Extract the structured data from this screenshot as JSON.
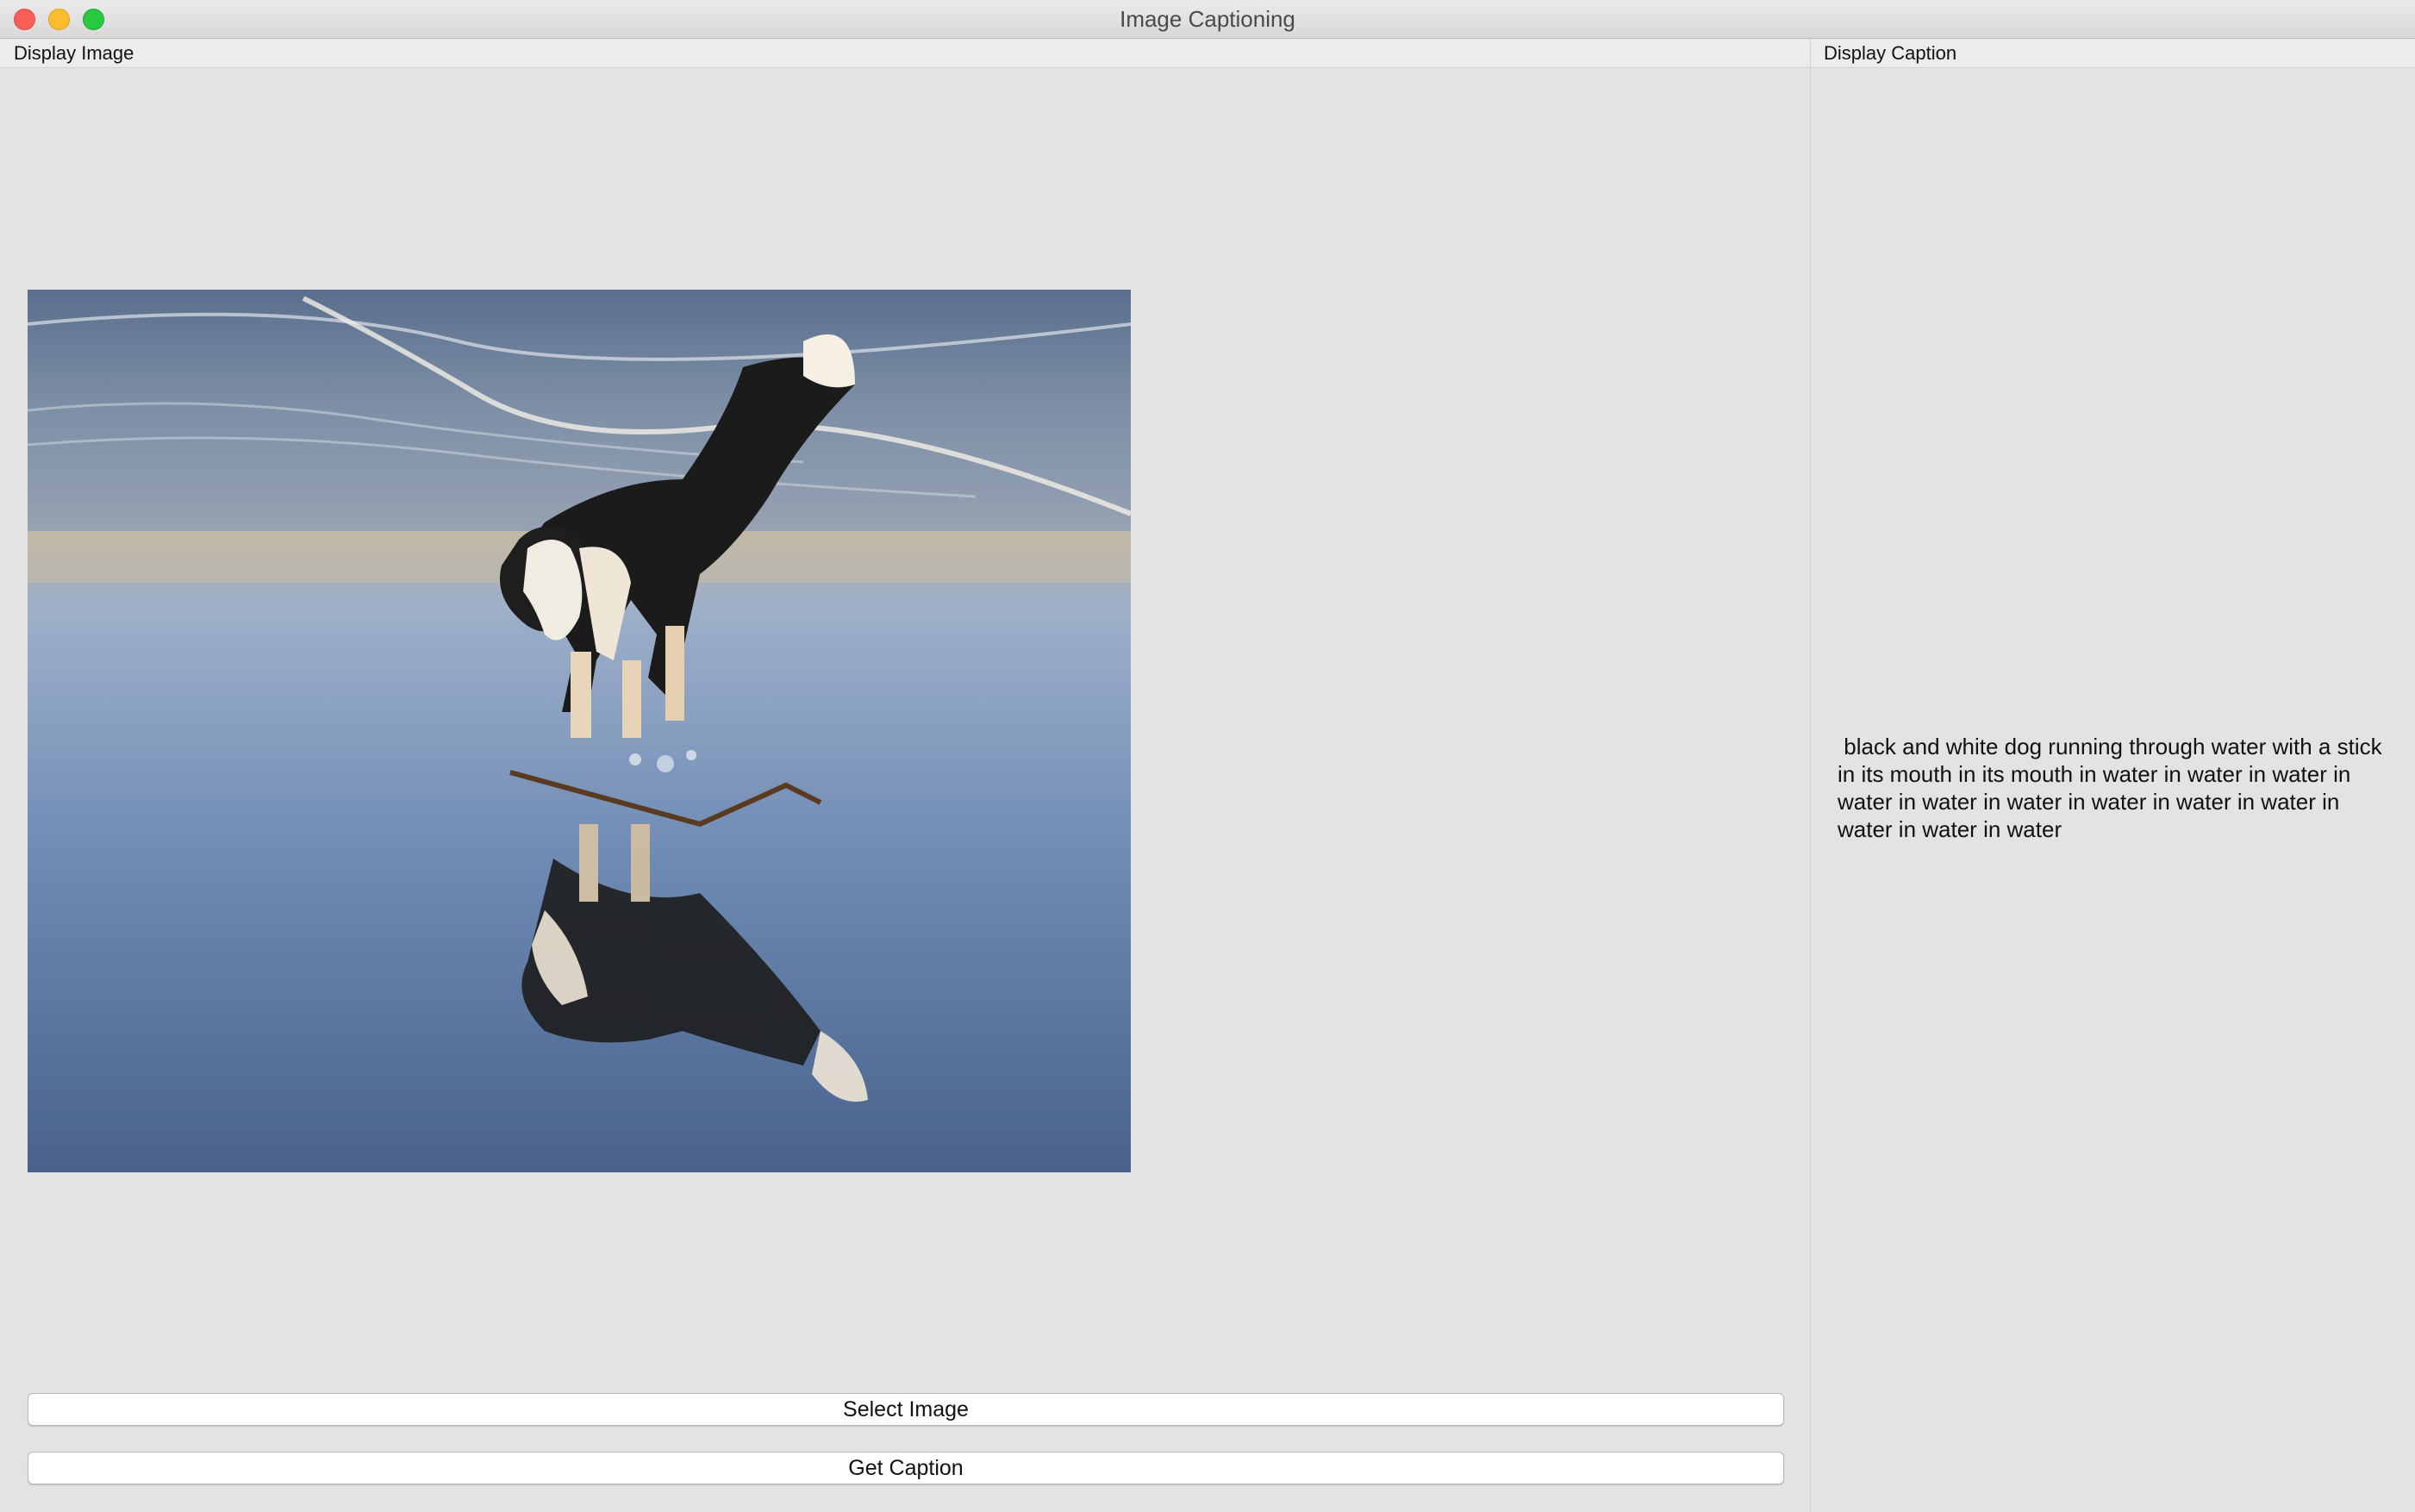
{
  "window": {
    "title": "Image Captioning"
  },
  "left_panel": {
    "header": "Display Image",
    "image_alt": "black and white dog on beach with stick"
  },
  "right_panel": {
    "header": "Display Caption",
    "caption": " black and white dog running through water with a stick in its mouth in its mouth in water in water in water in water in water in water in water in water in water in water in water in water"
  },
  "buttons": {
    "select_image": "Select Image",
    "get_caption": "Get Caption"
  },
  "colors": {
    "close": "#fc5f57",
    "minimize": "#fdbc2e",
    "zoom": "#28c840",
    "background": "#e3e3e3"
  }
}
